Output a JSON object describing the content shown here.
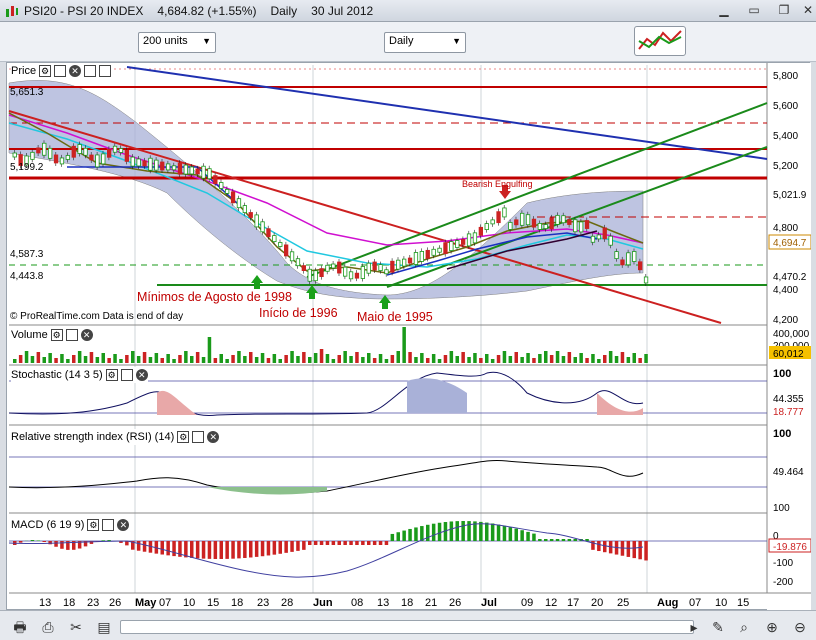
{
  "window": {
    "app_title": "PSI20 - PSI 20 INDEX",
    "price": "4,684.82 (+1.55%)",
    "period": "Daily",
    "date": "30 Jul 2012"
  },
  "toolbar": {
    "units_select": "200 units",
    "period_select": "Daily"
  },
  "price_panel": {
    "label": "Price",
    "axis_ticks": [
      "5,800",
      "5,600",
      "5,400",
      "5,200",
      "5,021.9",
      "4,800",
      "4,694.7",
      "4,470.2",
      "4,400",
      "4,200"
    ],
    "left_levels": [
      "5,651.3",
      "5,199.2",
      "4,587.3",
      "4,443.8"
    ],
    "annotations": [
      "Bearish Engulfing",
      "Mínimos de Agosto de 1998",
      "Início de 1996",
      "Maio de 1995"
    ],
    "credit": "© ProRealTime.com  Data is end of day"
  },
  "volume_panel": {
    "label": "Volume",
    "axis_ticks": [
      "400,000",
      "200,000"
    ],
    "last": "60,012"
  },
  "stochastic_panel": {
    "label": "Stochastic (14 3 5)",
    "axis_ticks": [
      "100"
    ],
    "values": [
      "44.355",
      "18.777"
    ]
  },
  "rsi_panel": {
    "label": "Relative strength index (RSI) (14)",
    "axis_ticks": [
      "100"
    ],
    "value": "49.464"
  },
  "macd_panel": {
    "label": "MACD (6 19 9)",
    "axis_ticks": [
      "100",
      "0",
      "-100",
      "-200"
    ],
    "value": "-19.876"
  },
  "x_axis": {
    "labels": [
      "13",
      "18",
      "23",
      "26",
      "May",
      "07",
      "10",
      "15",
      "18",
      "23",
      "28",
      "Jun",
      "08",
      "13",
      "18",
      "21",
      "26",
      "Jul",
      "09",
      "12",
      "17",
      "20",
      "25",
      "Aug",
      "07",
      "10",
      "15"
    ]
  },
  "colors": {
    "up": "#1a9a1a",
    "down": "#cc2222",
    "accent": "#c00000"
  }
}
